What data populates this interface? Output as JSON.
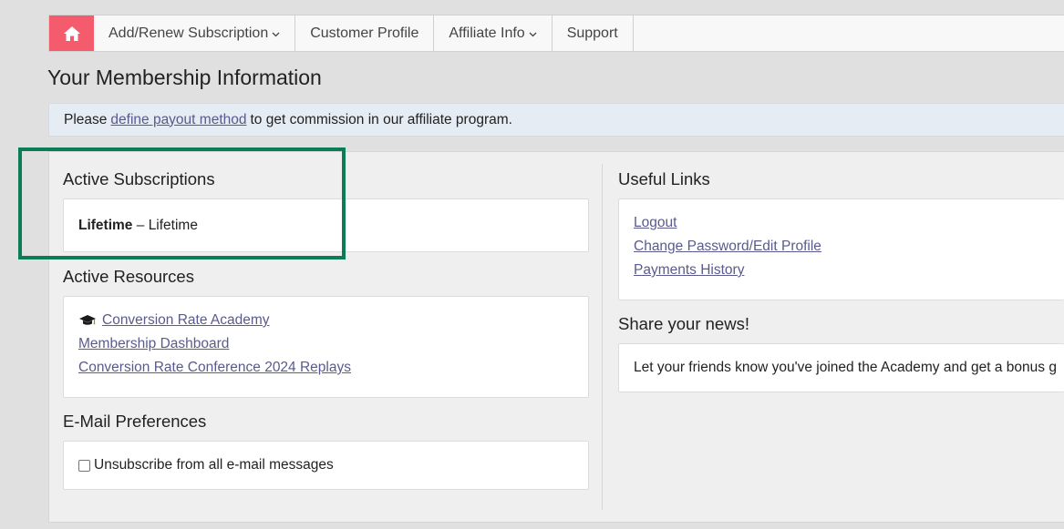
{
  "nav": {
    "items": [
      {
        "label": "Add/Renew Subscription",
        "chevron": "⌄"
      },
      {
        "label": "Customer Profile"
      },
      {
        "label": "Affiliate Info",
        "chevron": "⌄"
      },
      {
        "label": "Support"
      }
    ]
  },
  "page_title": "Your Membership Information",
  "notice": {
    "before": "Please",
    "link": "define payout method",
    "after": "to get commission in our affiliate program."
  },
  "active_subscriptions": {
    "title": "Active Subscriptions",
    "item_name": "Lifetime",
    "item_separator": "–",
    "item_term": "Lifetime"
  },
  "active_resources": {
    "title": "Active Resources",
    "links": [
      "Conversion Rate Academy",
      "Membership Dashboard",
      "Conversion Rate Conference 2024 Replays"
    ]
  },
  "email_prefs": {
    "title": "E-Mail Preferences",
    "checkbox_label": "Unsubscribe from all e-mail messages"
  },
  "useful_links": {
    "title": "Useful Links",
    "links": [
      "Logout",
      "Change Password/Edit Profile",
      "Payments History"
    ]
  },
  "share": {
    "title": "Share your news!",
    "text": "Let your friends know you've joined the Academy and get a bonus g"
  },
  "colors": {
    "home_button": "#f45b6c",
    "highlight_border": "#0b7d55",
    "link": "#5a5a8e"
  }
}
